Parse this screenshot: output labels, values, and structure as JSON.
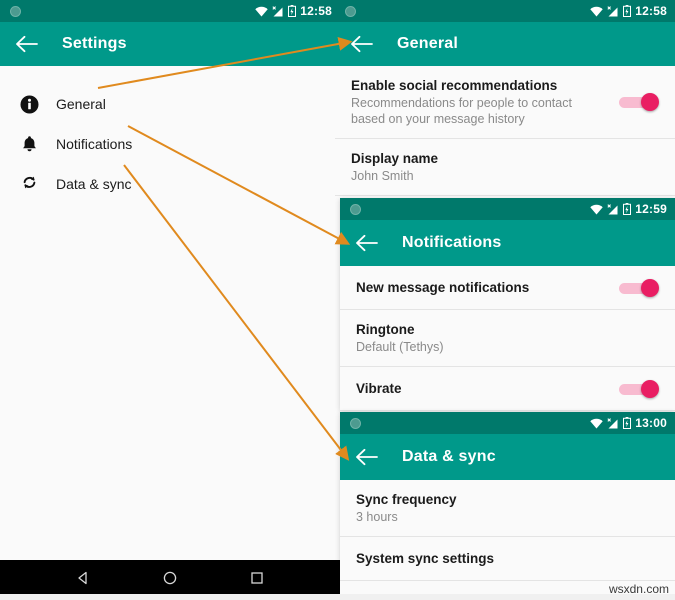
{
  "colors": {
    "statusbar": "#00796b",
    "appbar": "#00998a",
    "accent_toggle": "#e91e63",
    "toggle_track": "#f8bbd0",
    "arrow": "#e08a1e",
    "background": "#fafafa"
  },
  "left_screen": {
    "status": {
      "time": "12:58",
      "icons": [
        "wifi-icon",
        "signal-icon",
        "battery-icon"
      ]
    },
    "appbar": {
      "back_label": "back-arrow",
      "title": "Settings"
    },
    "nav_items": [
      {
        "icon": "info-icon",
        "label": "General"
      },
      {
        "icon": "bell-icon",
        "label": "Notifications"
      },
      {
        "icon": "sync-icon",
        "label": "Data & sync"
      }
    ],
    "navbar": {
      "back": "triangle-back",
      "home": "circle-home",
      "recents": "square-recents"
    }
  },
  "screen_general": {
    "status": {
      "time": "12:58"
    },
    "appbar": {
      "title": "General"
    },
    "rows": [
      {
        "primary": "Enable social recommendations",
        "secondary": "Recommendations for people to contact based on your message history",
        "control": "toggle",
        "toggle_on": true
      },
      {
        "primary": "Display name",
        "secondary": "John Smith",
        "control": "none"
      }
    ]
  },
  "screen_notifications": {
    "status": {
      "time": "12:59"
    },
    "appbar": {
      "title": "Notifications"
    },
    "rows": [
      {
        "primary": "New message notifications",
        "secondary": "",
        "control": "toggle",
        "toggle_on": true
      },
      {
        "primary": "Ringtone",
        "secondary": "Default (Tethys)",
        "control": "none"
      },
      {
        "primary": "Vibrate",
        "secondary": "",
        "control": "toggle",
        "toggle_on": true
      }
    ]
  },
  "screen_datasync": {
    "status": {
      "time": "13:00"
    },
    "appbar": {
      "title": "Data & sync"
    },
    "rows": [
      {
        "primary": "Sync frequency",
        "secondary": "3 hours",
        "control": "none"
      },
      {
        "primary": "System sync settings",
        "secondary": "",
        "control": "none"
      }
    ]
  },
  "annotations": {
    "arrows": [
      {
        "from_label": "General",
        "to_screen": "General"
      },
      {
        "from_label": "Notifications",
        "to_screen": "Notifications"
      },
      {
        "from_label": "Data & sync",
        "to_screen": "Data & sync"
      }
    ]
  },
  "watermark": {
    "text": "wsxdn.com"
  }
}
